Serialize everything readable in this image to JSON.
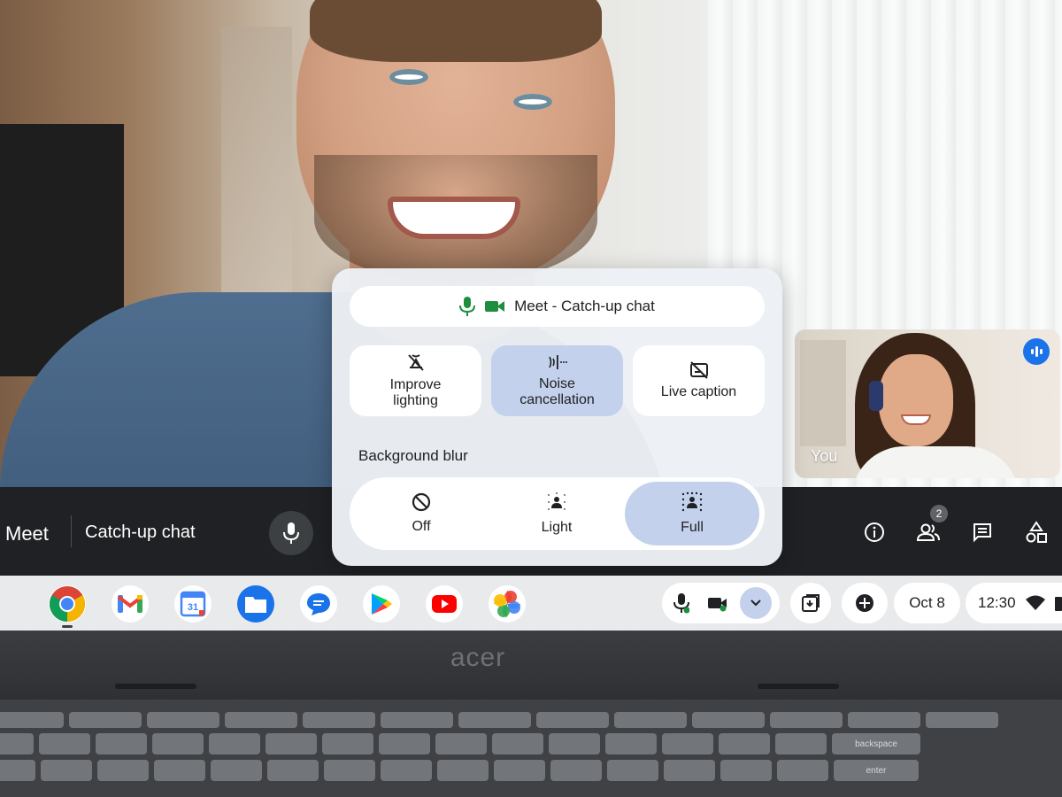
{
  "popup": {
    "header_title": "Meet - Catch-up chat",
    "tiles": [
      {
        "label": "Improve lighting",
        "icon": "lighting-off-icon",
        "active": false
      },
      {
        "label": "Noise cancellation",
        "icon": "noise-cancellation-icon",
        "active": true
      },
      {
        "label": "Live caption",
        "icon": "live-caption-off-icon",
        "active": false
      }
    ],
    "background_blur": {
      "heading": "Background blur",
      "options": [
        {
          "label": "Off",
          "icon": "blocked-icon",
          "active": false
        },
        {
          "label": "Light",
          "icon": "blur-light-icon",
          "active": false
        },
        {
          "label": "Full",
          "icon": "blur-full-icon",
          "active": true
        }
      ]
    }
  },
  "meet_bar": {
    "app_name": "Meet",
    "meeting_title": "Catch-up chat",
    "participant_count": "2"
  },
  "self_view": {
    "label": "You"
  },
  "shelf": {
    "apps": [
      "chrome-icon",
      "gmail-icon",
      "calendar-icon",
      "files-icon",
      "messages-icon",
      "play-store-icon",
      "youtube-icon",
      "photos-icon"
    ],
    "calendar_day": "31",
    "date": "Oct 8",
    "time": "12:30"
  },
  "laptop": {
    "brand": "acer"
  },
  "keyboard": {
    "backspace": "backspace",
    "enter": "enter"
  },
  "colors": {
    "accent_active": "#c3d1ec",
    "meet_bar": "#202124",
    "meet_green": "#1e8e3e",
    "speaking_blue": "#1a73e8"
  }
}
